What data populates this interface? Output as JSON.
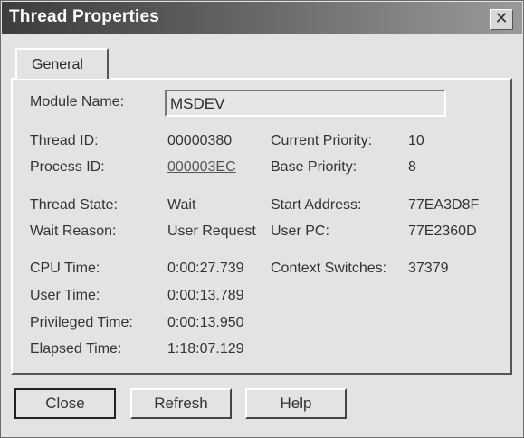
{
  "window": {
    "title": "Thread Properties",
    "close_glyph": "✕"
  },
  "tab": {
    "label": "General"
  },
  "module": {
    "label": "Module Name:",
    "value": "MSDEV"
  },
  "thread_id": {
    "label": "Thread ID:",
    "value": "00000380"
  },
  "process_id": {
    "label": "Process ID:",
    "value": "000003EC"
  },
  "current_priority": {
    "label": "Current Priority:",
    "value": "10"
  },
  "base_priority": {
    "label": "Base Priority:",
    "value": "8"
  },
  "thread_state": {
    "label": "Thread State:",
    "value": "Wait"
  },
  "start_address": {
    "label": "Start Address:",
    "value": "77EA3D8F"
  },
  "wait_reason": {
    "label": "Wait Reason:",
    "value": "User Request"
  },
  "user_pc": {
    "label": "User PC:",
    "value": "77E2360D"
  },
  "cpu_time": {
    "label": "CPU Time:",
    "value": "0:00:27.739"
  },
  "context_switches": {
    "label": "Context Switches:",
    "value": "37379"
  },
  "user_time": {
    "label": "User Time:",
    "value": "0:00:13.789"
  },
  "privileged_time": {
    "label": "Privileged Time:",
    "value": "0:00:13.950"
  },
  "elapsed_time": {
    "label": "Elapsed Time:",
    "value": "1:18:07.129"
  },
  "buttons": {
    "close": "Close",
    "refresh": "Refresh",
    "help": "Help"
  }
}
